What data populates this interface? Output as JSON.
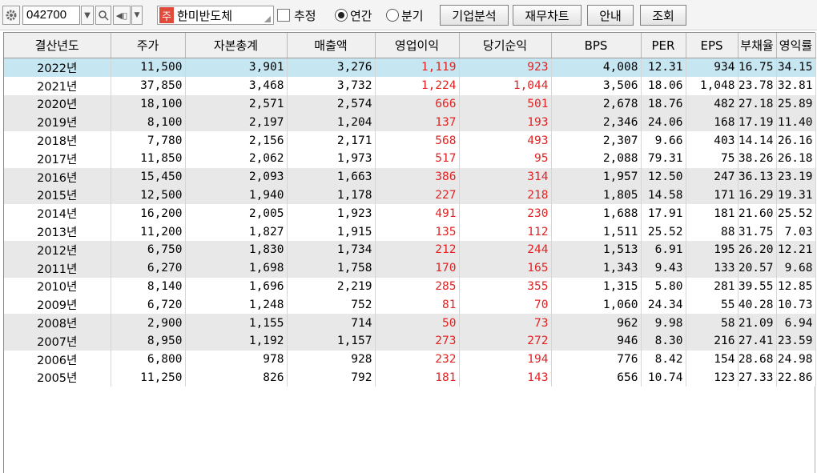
{
  "toolbar": {
    "settings_icon": "gear-icon",
    "stock_code": "042700",
    "stock_badge": "주",
    "stock_name": "한미반도체",
    "estimate_label": "추정",
    "annual_label": "연간",
    "quarterly_label": "분기",
    "annual_selected": true,
    "buttons": [
      "기업분석",
      "재무차트",
      "안내",
      "조회"
    ]
  },
  "table": {
    "columns": [
      "결산년도",
      "주가",
      "자본총계",
      "매출액",
      "영업이익",
      "당기순익",
      "BPS",
      "PER",
      "EPS",
      "부채율",
      "영익률"
    ],
    "red_columns": [
      4,
      5
    ],
    "selected_row": 0,
    "rows": [
      [
        "2022년",
        "11,500",
        "3,901",
        "3,276",
        "1,119",
        "923",
        "4,008",
        "12.31",
        "934",
        "16.75",
        "34.15"
      ],
      [
        "2021년",
        "37,850",
        "3,468",
        "3,732",
        "1,224",
        "1,044",
        "3,506",
        "18.06",
        "1,048",
        "23.78",
        "32.81"
      ],
      [
        "2020년",
        "18,100",
        "2,571",
        "2,574",
        "666",
        "501",
        "2,678",
        "18.76",
        "482",
        "27.18",
        "25.89"
      ],
      [
        "2019년",
        "8,100",
        "2,197",
        "1,204",
        "137",
        "193",
        "2,346",
        "24.06",
        "168",
        "17.19",
        "11.40"
      ],
      [
        "2018년",
        "7,780",
        "2,156",
        "2,171",
        "568",
        "493",
        "2,307",
        "9.66",
        "403",
        "14.14",
        "26.16"
      ],
      [
        "2017년",
        "11,850",
        "2,062",
        "1,973",
        "517",
        "95",
        "2,088",
        "79.31",
        "75",
        "38.26",
        "26.18"
      ],
      [
        "2016년",
        "15,450",
        "2,093",
        "1,663",
        "386",
        "314",
        "1,957",
        "12.50",
        "247",
        "36.13",
        "23.19"
      ],
      [
        "2015년",
        "12,500",
        "1,940",
        "1,178",
        "227",
        "218",
        "1,805",
        "14.58",
        "171",
        "16.29",
        "19.31"
      ],
      [
        "2014년",
        "16,200",
        "2,005",
        "1,923",
        "491",
        "230",
        "1,688",
        "17.91",
        "181",
        "21.60",
        "25.52"
      ],
      [
        "2013년",
        "11,200",
        "1,827",
        "1,915",
        "135",
        "112",
        "1,511",
        "25.52",
        "88",
        "31.75",
        "7.03"
      ],
      [
        "2012년",
        "6,750",
        "1,830",
        "1,734",
        "212",
        "244",
        "1,513",
        "6.91",
        "195",
        "26.20",
        "12.21"
      ],
      [
        "2011년",
        "6,270",
        "1,698",
        "1,758",
        "170",
        "165",
        "1,343",
        "9.43",
        "133",
        "20.57",
        "9.68"
      ],
      [
        "2010년",
        "8,140",
        "1,696",
        "2,219",
        "285",
        "355",
        "1,315",
        "5.80",
        "281",
        "39.55",
        "12.85"
      ],
      [
        "2009년",
        "6,720",
        "1,248",
        "752",
        "81",
        "70",
        "1,060",
        "24.34",
        "55",
        "40.28",
        "10.73"
      ],
      [
        "2008년",
        "2,900",
        "1,155",
        "714",
        "50",
        "73",
        "962",
        "9.98",
        "58",
        "21.09",
        "6.94"
      ],
      [
        "2007년",
        "8,950",
        "1,192",
        "1,157",
        "273",
        "272",
        "946",
        "8.30",
        "216",
        "27.41",
        "23.59"
      ],
      [
        "2006년",
        "6,800",
        "978",
        "928",
        "232",
        "194",
        "776",
        "8.42",
        "154",
        "28.68",
        "24.98"
      ],
      [
        "2005년",
        "11,250",
        "826",
        "792",
        "181",
        "143",
        "656",
        "10.74",
        "123",
        "27.33",
        "22.86"
      ]
    ]
  }
}
